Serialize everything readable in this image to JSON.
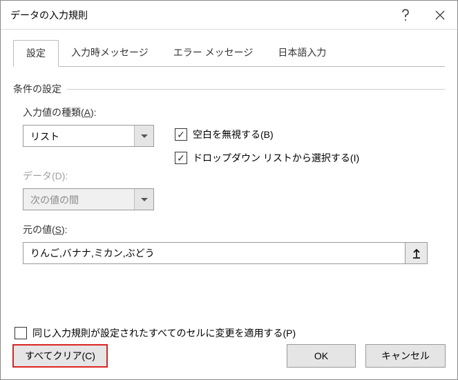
{
  "title": "データの入力規則",
  "tabs": {
    "settings": "設定",
    "input_msg": "入力時メッセージ",
    "error_msg": "エラー メッセージ",
    "ime": "日本語入力"
  },
  "legend": "条件の設定",
  "allow": {
    "label_pre": "入力値の種類(",
    "label_key": "A",
    "label_post": "):",
    "value": "リスト"
  },
  "data": {
    "label_pre": "データ(",
    "label_key": "D",
    "label_post": "):",
    "value": "次の値の間"
  },
  "ignore_blank": {
    "pre": "空白を無視する(",
    "key": "B",
    "post": ")"
  },
  "dropdown": {
    "pre": "ドロップダウン リストから選択する(",
    "key": "I",
    "post": ")"
  },
  "source": {
    "label_pre": "元の値(",
    "label_key": "S",
    "label_post": "):",
    "value": "りんご,バナナ,ミカン,ぶどう"
  },
  "apply_all": {
    "pre": "同じ入力規則が設定されたすべてのセルに変更を適用する(",
    "key": "P",
    "post": ")"
  },
  "buttons": {
    "clear_pre": "すべてクリア(",
    "clear_key": "C",
    "clear_post": ")",
    "ok": "OK",
    "cancel": "キャンセル"
  }
}
